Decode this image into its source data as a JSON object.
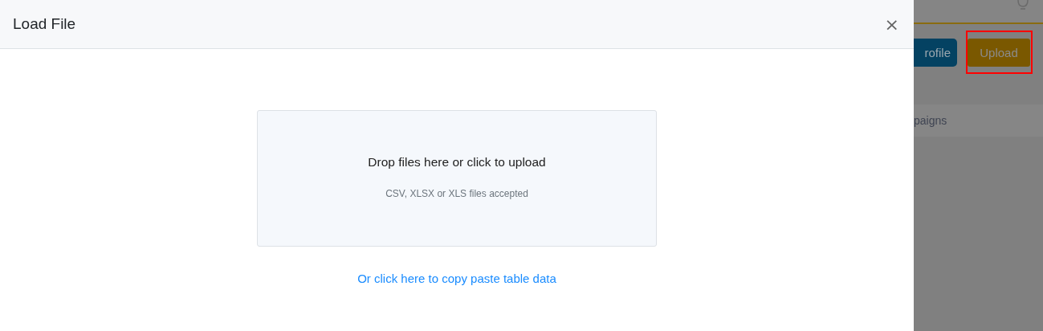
{
  "modal": {
    "title": "Load File",
    "close": "×",
    "dropzone": {
      "message": "Drop files here or click to upload",
      "hint": "CSV, XLSX or XLS files accepted"
    },
    "paste_link": "Or click here to copy paste table data"
  },
  "background": {
    "buttons": [
      {
        "label": "rofile",
        "kind": "profile",
        "highlighted": false
      },
      {
        "label": "Upload",
        "kind": "upload",
        "highlighted": true
      }
    ],
    "list_item": "paigns"
  }
}
